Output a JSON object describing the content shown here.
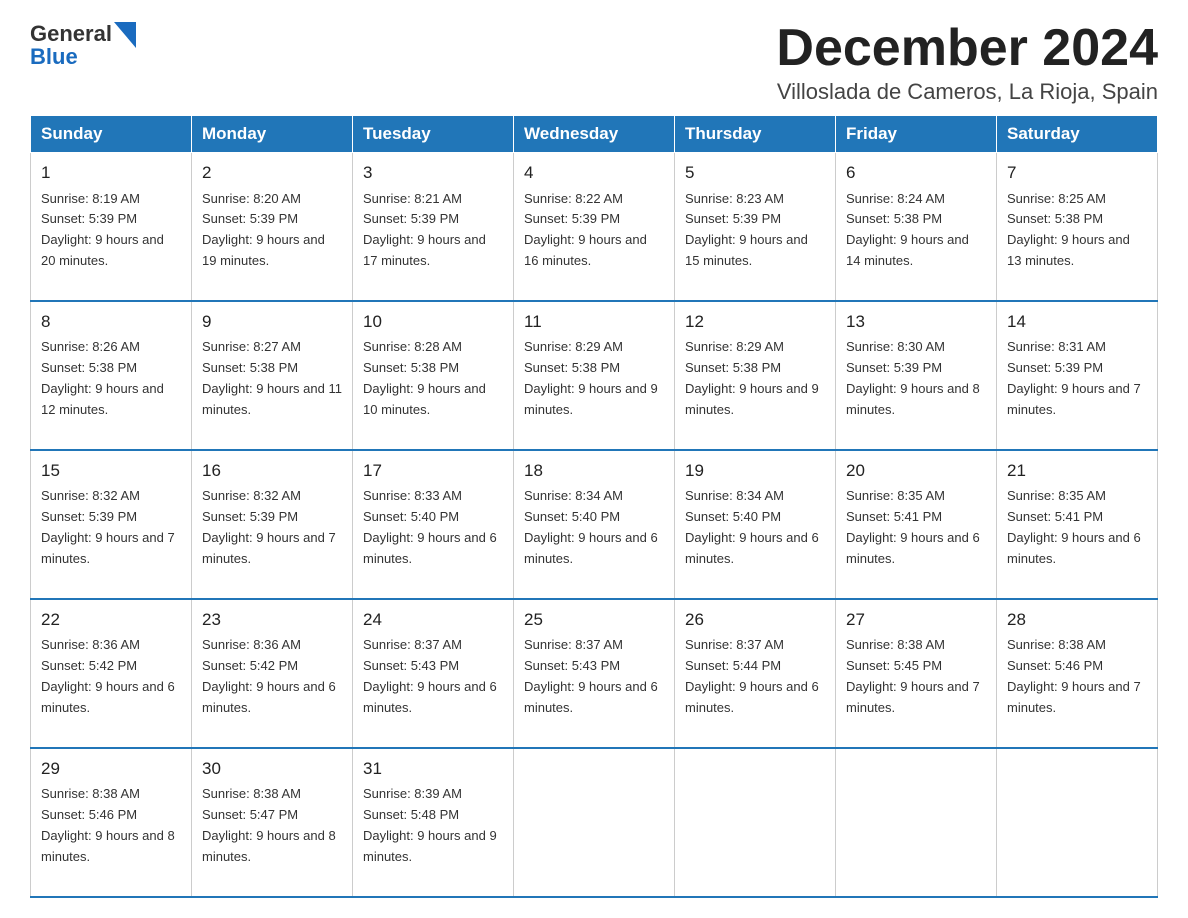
{
  "logo": {
    "line1": "General",
    "line2": "Blue"
  },
  "title": "December 2024",
  "location": "Villoslada de Cameros, La Rioja, Spain",
  "weekdays": [
    "Sunday",
    "Monday",
    "Tuesday",
    "Wednesday",
    "Thursday",
    "Friday",
    "Saturday"
  ],
  "weeks": [
    [
      {
        "day": "1",
        "sunrise": "Sunrise: 8:19 AM",
        "sunset": "Sunset: 5:39 PM",
        "daylight": "Daylight: 9 hours and 20 minutes."
      },
      {
        "day": "2",
        "sunrise": "Sunrise: 8:20 AM",
        "sunset": "Sunset: 5:39 PM",
        "daylight": "Daylight: 9 hours and 19 minutes."
      },
      {
        "day": "3",
        "sunrise": "Sunrise: 8:21 AM",
        "sunset": "Sunset: 5:39 PM",
        "daylight": "Daylight: 9 hours and 17 minutes."
      },
      {
        "day": "4",
        "sunrise": "Sunrise: 8:22 AM",
        "sunset": "Sunset: 5:39 PM",
        "daylight": "Daylight: 9 hours and 16 minutes."
      },
      {
        "day": "5",
        "sunrise": "Sunrise: 8:23 AM",
        "sunset": "Sunset: 5:39 PM",
        "daylight": "Daylight: 9 hours and 15 minutes."
      },
      {
        "day": "6",
        "sunrise": "Sunrise: 8:24 AM",
        "sunset": "Sunset: 5:38 PM",
        "daylight": "Daylight: 9 hours and 14 minutes."
      },
      {
        "day": "7",
        "sunrise": "Sunrise: 8:25 AM",
        "sunset": "Sunset: 5:38 PM",
        "daylight": "Daylight: 9 hours and 13 minutes."
      }
    ],
    [
      {
        "day": "8",
        "sunrise": "Sunrise: 8:26 AM",
        "sunset": "Sunset: 5:38 PM",
        "daylight": "Daylight: 9 hours and 12 minutes."
      },
      {
        "day": "9",
        "sunrise": "Sunrise: 8:27 AM",
        "sunset": "Sunset: 5:38 PM",
        "daylight": "Daylight: 9 hours and 11 minutes."
      },
      {
        "day": "10",
        "sunrise": "Sunrise: 8:28 AM",
        "sunset": "Sunset: 5:38 PM",
        "daylight": "Daylight: 9 hours and 10 minutes."
      },
      {
        "day": "11",
        "sunrise": "Sunrise: 8:29 AM",
        "sunset": "Sunset: 5:38 PM",
        "daylight": "Daylight: 9 hours and 9 minutes."
      },
      {
        "day": "12",
        "sunrise": "Sunrise: 8:29 AM",
        "sunset": "Sunset: 5:38 PM",
        "daylight": "Daylight: 9 hours and 9 minutes."
      },
      {
        "day": "13",
        "sunrise": "Sunrise: 8:30 AM",
        "sunset": "Sunset: 5:39 PM",
        "daylight": "Daylight: 9 hours and 8 minutes."
      },
      {
        "day": "14",
        "sunrise": "Sunrise: 8:31 AM",
        "sunset": "Sunset: 5:39 PM",
        "daylight": "Daylight: 9 hours and 7 minutes."
      }
    ],
    [
      {
        "day": "15",
        "sunrise": "Sunrise: 8:32 AM",
        "sunset": "Sunset: 5:39 PM",
        "daylight": "Daylight: 9 hours and 7 minutes."
      },
      {
        "day": "16",
        "sunrise": "Sunrise: 8:32 AM",
        "sunset": "Sunset: 5:39 PM",
        "daylight": "Daylight: 9 hours and 7 minutes."
      },
      {
        "day": "17",
        "sunrise": "Sunrise: 8:33 AM",
        "sunset": "Sunset: 5:40 PM",
        "daylight": "Daylight: 9 hours and 6 minutes."
      },
      {
        "day": "18",
        "sunrise": "Sunrise: 8:34 AM",
        "sunset": "Sunset: 5:40 PM",
        "daylight": "Daylight: 9 hours and 6 minutes."
      },
      {
        "day": "19",
        "sunrise": "Sunrise: 8:34 AM",
        "sunset": "Sunset: 5:40 PM",
        "daylight": "Daylight: 9 hours and 6 minutes."
      },
      {
        "day": "20",
        "sunrise": "Sunrise: 8:35 AM",
        "sunset": "Sunset: 5:41 PM",
        "daylight": "Daylight: 9 hours and 6 minutes."
      },
      {
        "day": "21",
        "sunrise": "Sunrise: 8:35 AM",
        "sunset": "Sunset: 5:41 PM",
        "daylight": "Daylight: 9 hours and 6 minutes."
      }
    ],
    [
      {
        "day": "22",
        "sunrise": "Sunrise: 8:36 AM",
        "sunset": "Sunset: 5:42 PM",
        "daylight": "Daylight: 9 hours and 6 minutes."
      },
      {
        "day": "23",
        "sunrise": "Sunrise: 8:36 AM",
        "sunset": "Sunset: 5:42 PM",
        "daylight": "Daylight: 9 hours and 6 minutes."
      },
      {
        "day": "24",
        "sunrise": "Sunrise: 8:37 AM",
        "sunset": "Sunset: 5:43 PM",
        "daylight": "Daylight: 9 hours and 6 minutes."
      },
      {
        "day": "25",
        "sunrise": "Sunrise: 8:37 AM",
        "sunset": "Sunset: 5:43 PM",
        "daylight": "Daylight: 9 hours and 6 minutes."
      },
      {
        "day": "26",
        "sunrise": "Sunrise: 8:37 AM",
        "sunset": "Sunset: 5:44 PM",
        "daylight": "Daylight: 9 hours and 6 minutes."
      },
      {
        "day": "27",
        "sunrise": "Sunrise: 8:38 AM",
        "sunset": "Sunset: 5:45 PM",
        "daylight": "Daylight: 9 hours and 7 minutes."
      },
      {
        "day": "28",
        "sunrise": "Sunrise: 8:38 AM",
        "sunset": "Sunset: 5:46 PM",
        "daylight": "Daylight: 9 hours and 7 minutes."
      }
    ],
    [
      {
        "day": "29",
        "sunrise": "Sunrise: 8:38 AM",
        "sunset": "Sunset: 5:46 PM",
        "daylight": "Daylight: 9 hours and 8 minutes."
      },
      {
        "day": "30",
        "sunrise": "Sunrise: 8:38 AM",
        "sunset": "Sunset: 5:47 PM",
        "daylight": "Daylight: 9 hours and 8 minutes."
      },
      {
        "day": "31",
        "sunrise": "Sunrise: 8:39 AM",
        "sunset": "Sunset: 5:48 PM",
        "daylight": "Daylight: 9 hours and 9 minutes."
      },
      null,
      null,
      null,
      null
    ]
  ]
}
